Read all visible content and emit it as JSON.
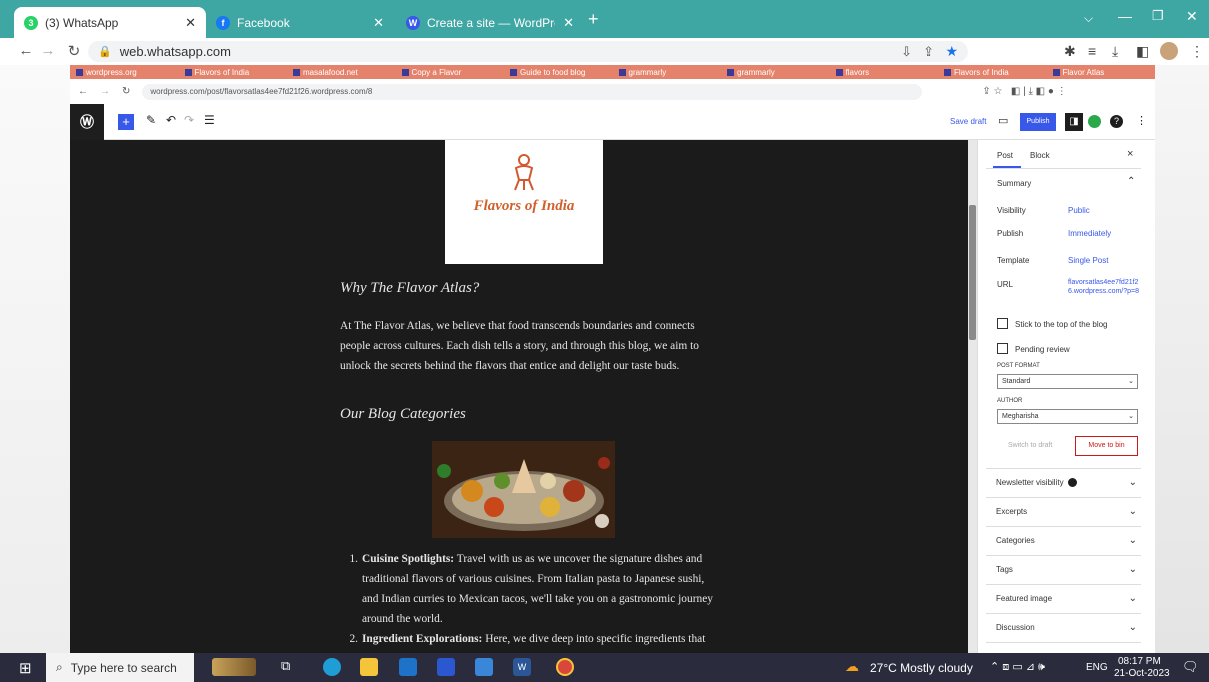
{
  "browser": {
    "tabs": [
      {
        "label": "(3) WhatsApp",
        "active": true,
        "icon": "whatsapp-icon",
        "icon_color": "#25d366"
      },
      {
        "label": "Facebook",
        "active": false,
        "icon": "facebook-icon",
        "icon_color": "#1877f2"
      },
      {
        "label": "Create a site — WordPress.com",
        "active": false,
        "icon": "wordpress-icon",
        "icon_color": "#3858e9"
      }
    ],
    "new_tab": "+",
    "url": "web.whatsapp.com"
  },
  "inner_browser": {
    "tabs": [
      "wordpress.org",
      "Flavors of India",
      "masalafood.net",
      "Copy a Flavor",
      "Guide to food blog",
      "grammarly",
      "grammarly",
      "flavors",
      "Flavors of India",
      "Flavor Atlas"
    ],
    "url": "wordpress.com/post/flavorsatlas4ee7fd21f26.wordpress.com/8"
  },
  "editor": {
    "save_draft": "Save draft",
    "publish": "Publish"
  },
  "post": {
    "logo_text": "Flavors of India",
    "heading1": "Why The Flavor Atlas?",
    "paragraph1": "At The Flavor Atlas, we believe that food transcends boundaries and connects people across cultures. Each dish tells a story, and through this blog, we aim to unlock the secrets behind the flavors that entice and delight our taste buds.",
    "heading2": "Our Blog Categories",
    "list": [
      {
        "num": "1.",
        "bold": "Cuisine Spotlights:",
        "text": "Travel with us as we uncover the signature dishes and traditional flavors of various cuisines. From Italian pasta to Japanese sushi, and Indian curries to Mexican tacos, we'll take you on a gastronomic journey around the world."
      },
      {
        "num": "2.",
        "bold": "Ingredient Explorations:",
        "text": "Here, we dive deep into specific ingredients that form the backbone of culinary traditions, from spices and herbs"
      }
    ]
  },
  "sidebar": {
    "tabs": [
      "Post",
      "Block"
    ],
    "close": "×",
    "summary_title": "Summary",
    "rows": [
      {
        "label": "Visibility",
        "value": "Public"
      },
      {
        "label": "Publish",
        "value": "Immediately"
      },
      {
        "label": "Template",
        "value": "Single Post"
      },
      {
        "label": "URL",
        "value": "flavorsatlas4ee7fd21f26.wordpress.com/?p=8"
      }
    ],
    "checkbox_sticky": "Stick to the top of the blog",
    "checkbox_pending": "Pending review",
    "post_format_label": "POST FORMAT",
    "post_format_value": "Standard",
    "author_label": "AUTHOR",
    "author_value": "Megharisha",
    "switch_to_draft": "Switch to draft",
    "move_to_bin": "Move to bin",
    "panels": [
      "Newsletter visibility",
      "Excerpts",
      "Categories",
      "Tags",
      "Featured image",
      "Discussion"
    ]
  },
  "taskbar": {
    "search_placeholder": "Type here to search",
    "weather": "27°C  Mostly cloudy",
    "lang": "ENG",
    "time": "08:17 PM",
    "date": "21-Oct-2023"
  }
}
